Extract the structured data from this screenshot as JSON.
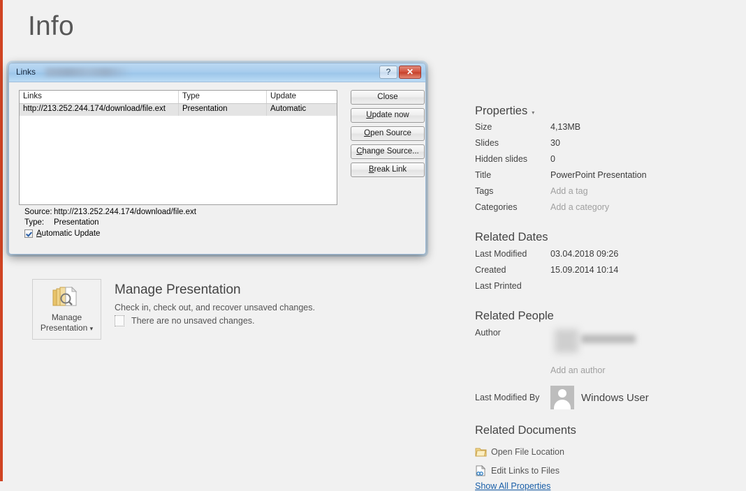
{
  "page": {
    "title": "Info",
    "accent_color": "#d04423",
    "background_color": "#f1f1f1"
  },
  "dialog": {
    "title": "Links",
    "help_button": "?",
    "close_button": "✕",
    "columns": [
      "Links",
      "Type",
      "Update"
    ],
    "rows": [
      {
        "link": "http://213.252.244.174/download/file.ext",
        "type": "Presentation",
        "update": "Automatic"
      }
    ],
    "buttons": [
      {
        "label": "Close",
        "accel": ""
      },
      {
        "label": "Update now",
        "accel": "U"
      },
      {
        "label": "Open Source",
        "accel": "O"
      },
      {
        "label": "Change Source...",
        "accel": "C"
      },
      {
        "label": "Break Link",
        "accel": "B"
      }
    ],
    "source_label": "Source:",
    "source_value": "http://213.252.244.174/download/file.ext",
    "type_label": "Type:",
    "type_value": "Presentation",
    "automatic_update_label": "Automatic Update",
    "automatic_update_checked": true
  },
  "manage": {
    "button_label_line1": "Manage",
    "button_label_line2": "Presentation",
    "button_caret": "▾",
    "heading": "Manage Presentation",
    "description": "Check in, check out, and recover unsaved changes.",
    "status": "There are no unsaved changes.",
    "icon": "document-stack-search-icon"
  },
  "properties": {
    "heading": "Properties",
    "caret": "▾",
    "rows": [
      {
        "label": "Size",
        "value": "4,13MB",
        "placeholder": false
      },
      {
        "label": "Slides",
        "value": "30",
        "placeholder": false
      },
      {
        "label": "Hidden slides",
        "value": "0",
        "placeholder": false
      },
      {
        "label": "Title",
        "value": "PowerPoint Presentation",
        "placeholder": false
      },
      {
        "label": "Tags",
        "value": "Add a tag",
        "placeholder": true
      },
      {
        "label": "Categories",
        "value": "Add a category",
        "placeholder": true
      }
    ]
  },
  "related_dates": {
    "heading": "Related Dates",
    "rows": [
      {
        "label": "Last Modified",
        "value": "03.04.2018 09:26"
      },
      {
        "label": "Created",
        "value": "15.09.2014 10:14"
      },
      {
        "label": "Last Printed",
        "value": ""
      }
    ]
  },
  "related_people": {
    "heading": "Related People",
    "author_label": "Author",
    "author_value": "",
    "add_author_label": "Add an author",
    "last_modified_by_label": "Last Modified By",
    "last_modified_by_name": "Windows User"
  },
  "related_documents": {
    "heading": "Related Documents",
    "open_file_location": "Open File Location",
    "edit_links_to_files": "Edit Links to Files",
    "show_all_properties": "Show All Properties",
    "show_all_properties_color": "#1a5fa8"
  }
}
